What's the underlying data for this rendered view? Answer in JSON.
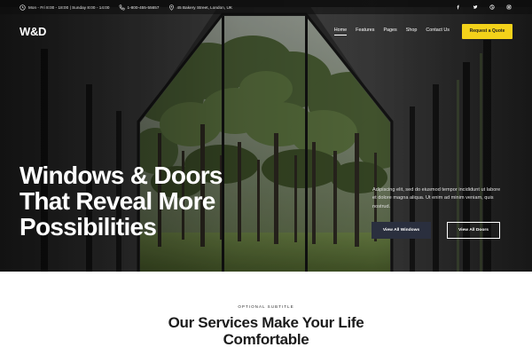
{
  "topbar": {
    "hours": "Mon - Fri 8:00 - 18:00  |  Sunday 8:00 - 14:00",
    "phone": "1-800-455-55657",
    "address": "45 Bakery Street, London, UK",
    "social": [
      "facebook-icon",
      "twitter-icon",
      "dribbble-icon",
      "instagram-icon"
    ]
  },
  "header": {
    "logo": "W&D",
    "nav": [
      "Home",
      "Features",
      "Pages",
      "Shop",
      "Contact Us"
    ],
    "active_nav": "Home",
    "cta": "Request a Quote"
  },
  "hero": {
    "title_lines": [
      "Windows & Doors",
      "That Reveal More",
      "Possibilities"
    ],
    "description": "Adipiscing elit, sed do eiusmod tempor incididunt ut labore et dolore magna aliqua. Ut enim ad minim veniam, quis nostrud.",
    "primary_button": "View All Windows",
    "secondary_button": "View All Doors"
  },
  "services": {
    "subtitle": "OPTIONAL SUBTITLE",
    "title_lines": [
      "Our Services Make Your Life",
      "Comfortable"
    ]
  },
  "colors": {
    "accent": "#f3d21a",
    "dark_button": "#2a2f3e",
    "forest_green": "#4f6a3b"
  }
}
